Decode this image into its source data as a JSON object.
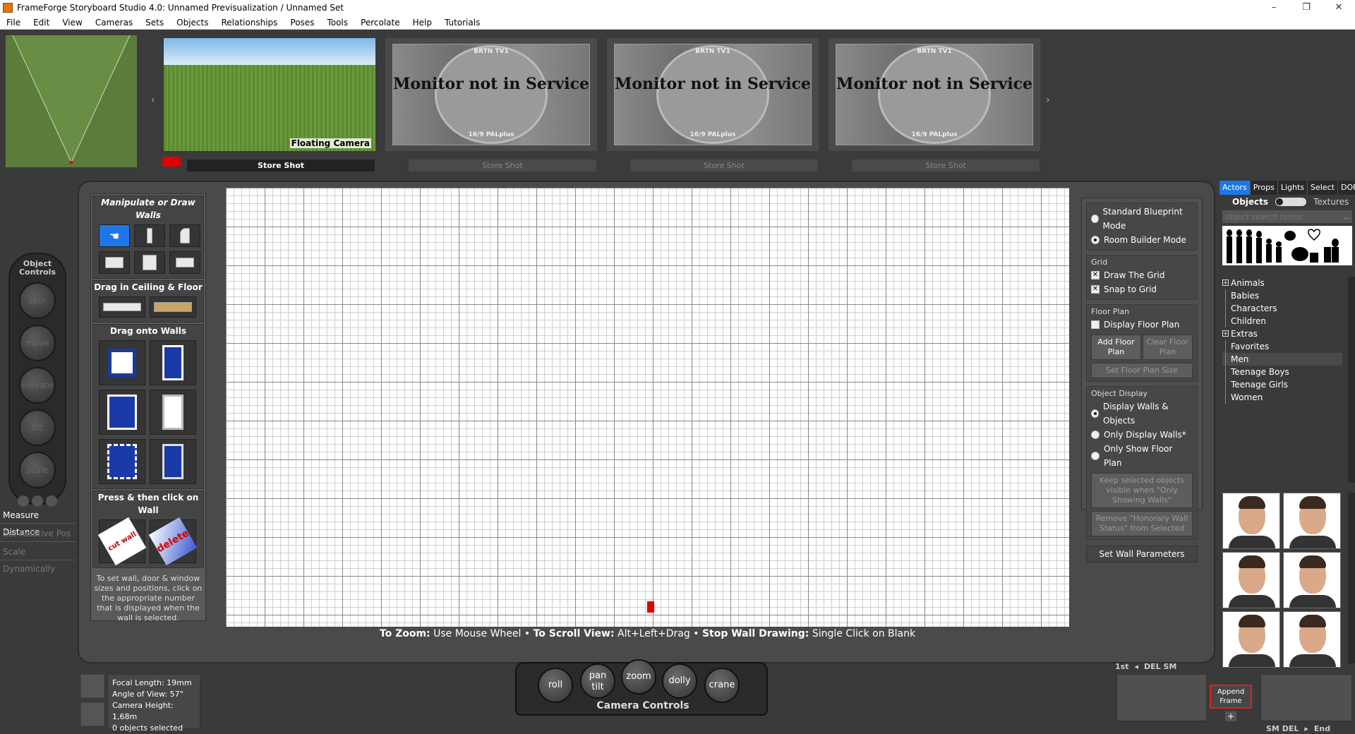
{
  "window": {
    "title": "FrameForge Storyboard Studio 4.0:  Unnamed Previsualization  /  Unnamed Set",
    "minimize": "–",
    "maximize": "❐",
    "close": "✕"
  },
  "menu": [
    "File",
    "Edit",
    "View",
    "Cameras",
    "Sets",
    "Objects",
    "Relationships",
    "Poses",
    "Tools",
    "Percolate",
    "Help",
    "Tutorials"
  ],
  "shots": {
    "prev_arrow": "‹",
    "next_arrow": "›",
    "active_label": "Floating Camera",
    "monitor_text": "Monitor not in Service",
    "monitor_brand": "BRTN TV1",
    "monitor_pal": "16/9 PALplus",
    "store_label": "Store Shot"
  },
  "object_controls": {
    "title": "Object Controls",
    "buttons": [
      "spin",
      "move",
      "elevate",
      "tilt",
      "scale"
    ]
  },
  "left_links": {
    "measure": "Measure Distance",
    "relative": "Set Relative Pos",
    "scale": "Scale Dynamically"
  },
  "tools": {
    "manipulate_title": "Manipulate or Draw Walls",
    "ceiling_title": "Drag in Ceiling & Floor",
    "walls_title": "Drag onto Walls",
    "press_title": "Press & then click on Wall",
    "cut_label": "cut wall",
    "delete_label": "delete",
    "help": "To set wall, door & window sizes and positions, click on the appropriate number that is displayed when the wall is selected."
  },
  "help_line": {
    "zoom_label": "To Zoom:",
    "zoom_text": " Use Mouse Wheel • ",
    "scroll_label": "To Scroll View:",
    "scroll_text": " Alt+Left+Drag • ",
    "stop_label": "Stop Wall Drawing:",
    "stop_text": " Single Click on Blank"
  },
  "options": {
    "modes": [
      "Standard Blueprint Mode",
      "Room Builder Mode"
    ],
    "grid_title": "Grid",
    "draw_grid": "Draw The Grid",
    "snap_grid": "Snap to Grid",
    "floor_title": "Floor Plan",
    "display_floor": "Display Floor Plan",
    "add_floor": "Add Floor Plan",
    "clear_floor": "Clear Floor Plan",
    "set_size": "Set Floor Plan Size",
    "display_title": "Object Display",
    "display_modes": [
      "Display Walls & Objects",
      "Only Display Walls*",
      "Only Show Floor Plan"
    ],
    "keep_visible": "Keep selected objects visible when \"Only Showing Walls\"",
    "remove_honorary": "Remove \"Honorary Wall Status\" from Selected",
    "set_wall_params": "Set Wall Parameters"
  },
  "library": {
    "tabs": [
      "Actors",
      "Props",
      "Lights",
      "Select",
      "DOF"
    ],
    "objects_label": "Objects",
    "textures_label": "Textures",
    "search_placeholder": "object search terms",
    "search_more": "...",
    "categories": [
      "Animals",
      "Babies",
      "Characters",
      "Children",
      "Extras",
      "Favorites",
      "Men",
      "Teenage Boys",
      "Teenage Girls",
      "Women"
    ],
    "selected_category": "Men"
  },
  "camera_info": {
    "focal": "Focal Length: 19mm",
    "angle": "Angle of View: 57°",
    "height": "Camera Height: 1,68m",
    "selected": "0 objects selected"
  },
  "camera_controls": {
    "title": "Camera Controls",
    "roll": "roll",
    "pan": "pan",
    "tilt": "tilt",
    "zoom": "zoom",
    "dolly": "dolly",
    "crane": "crane"
  },
  "frames": {
    "first": "1st",
    "prev": "◂",
    "del_sm": "DEL SM",
    "append": "Append Frame",
    "plus": "+",
    "sm_del": "SM DEL",
    "next": "▸",
    "end": "End"
  },
  "colors": {
    "accent": "#1d77e8",
    "record": "#e00000"
  }
}
